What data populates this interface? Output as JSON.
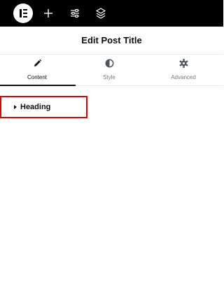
{
  "topbar": {
    "logo_icon": "elementor-logo-icon",
    "add_icon": "plus-icon",
    "settings_icon": "sliders-icon",
    "structure_icon": "layers-icon"
  },
  "panel": {
    "title": "Edit Post Title"
  },
  "tabs": [
    {
      "label": "Content",
      "icon": "pencil-icon",
      "active": true
    },
    {
      "label": "Style",
      "icon": "half-circle-icon",
      "active": false
    },
    {
      "label": "Advanced",
      "icon": "gear-icon",
      "active": false
    }
  ],
  "sections": [
    {
      "label": "Heading",
      "icon": "caret-right-icon",
      "expanded": false
    }
  ],
  "colors": {
    "topbar_bg": "#000000",
    "highlight_border": "#e10000",
    "text_primary": "#0c0d0e",
    "text_muted": "#6d7882"
  }
}
